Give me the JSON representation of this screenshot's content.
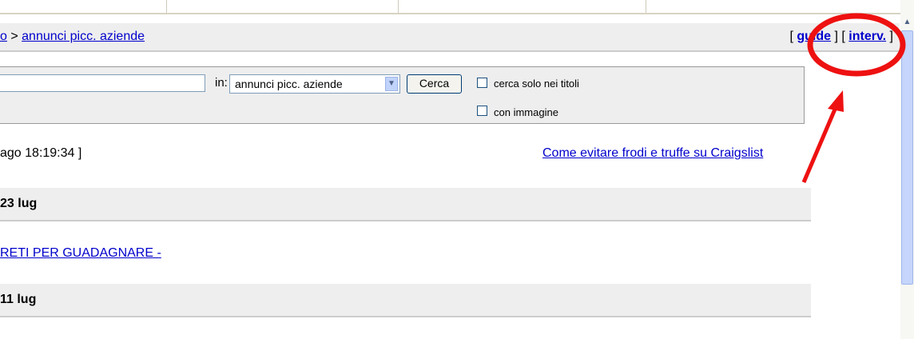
{
  "breadcrumb": {
    "prefix": "o",
    "separator": " > ",
    "current": "annunci picc. aziende"
  },
  "header_links": {
    "open_bracket": "[ ",
    "guide": "guide",
    "sep": " ] [ ",
    "help": "interv.",
    "close_bracket": " ]"
  },
  "search": {
    "query_value": "",
    "in_label": "in:",
    "category_selected": "annunci picc. aziende",
    "button": "Cerca",
    "option_titles": "cerca solo nei titoli",
    "option_image": "con immagine"
  },
  "timestamp": "ago 18:19:34 ]",
  "fraud_link": "Come evitare frodi e truffe su Craigslist",
  "listings": [
    {
      "date": "23 lug",
      "posts": [
        "RETI PER GUADAGNARE -"
      ]
    },
    {
      "date": "11 lug",
      "posts": []
    }
  ],
  "annotation": {
    "color": "#ee1111",
    "highlight": "help-link"
  },
  "colors": {
    "link": "#0000cc",
    "panel": "#eeeeee"
  }
}
